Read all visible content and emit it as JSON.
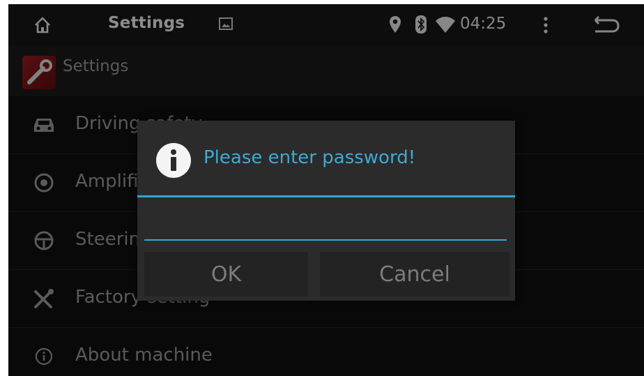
{
  "status_bar": {
    "title": "Settings",
    "time": "04:25",
    "icons": [
      "home-icon",
      "picture-icon",
      "location-icon",
      "bluetooth-icon",
      "wifi-icon",
      "more-icon",
      "back-icon"
    ]
  },
  "header": {
    "title": "Settings",
    "icon": "settings-app-icon"
  },
  "menu": {
    "items": [
      {
        "label": "Driving safety",
        "icon": "car-icon"
      },
      {
        "label": "Amplifier",
        "icon": "amplifier-icon"
      },
      {
        "label": "Steering wheel",
        "icon": "steering-wheel-icon"
      },
      {
        "label": "Factory setting",
        "icon": "tools-icon"
      },
      {
        "label": "About machine",
        "icon": "info-circle-icon"
      }
    ]
  },
  "dialog": {
    "title": "Please enter password!",
    "password_value": "",
    "ok_label": "OK",
    "cancel_label": "Cancel",
    "accent_color": "#33a7d3"
  }
}
